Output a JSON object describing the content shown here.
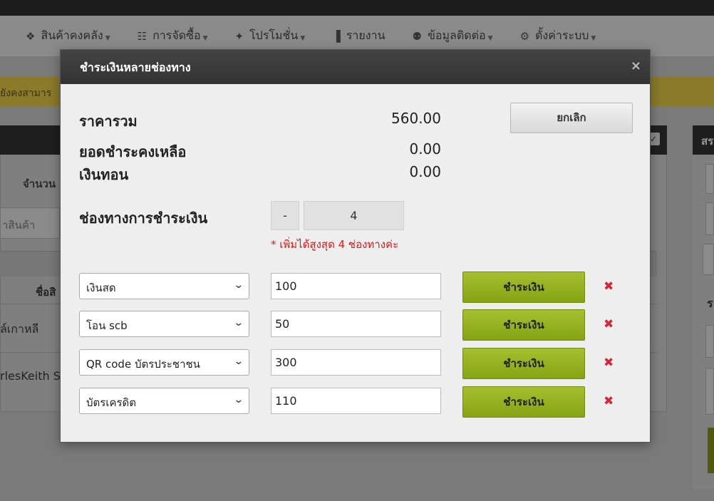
{
  "nav": {
    "items": [
      {
        "icon": "cubes-icon",
        "glyph": "❖",
        "label": "สินค้าคงคลัง",
        "dropdown": true
      },
      {
        "icon": "document-icon",
        "glyph": "☷",
        "label": "การจัดซื้อ",
        "dropdown": true
      },
      {
        "icon": "gift-icon",
        "glyph": "✦",
        "label": "โปรโมชั่น",
        "dropdown": true
      },
      {
        "icon": "bar-chart-icon",
        "glyph": "▐",
        "label": "รายงาน",
        "dropdown": false
      },
      {
        "icon": "users-icon",
        "glyph": "⚉",
        "label": "ข้อมูลติดต่อ",
        "dropdown": true
      },
      {
        "icon": "gear-icon",
        "glyph": "⚙",
        "label": "ตั้งค่าระบบ",
        "dropdown": true
      }
    ]
  },
  "background": {
    "alert_text": "ยังคงสามาร",
    "qty_label": "จำนวน",
    "search_placeholder": "าสินค้า",
    "col_name": "ชื่อสิ",
    "row1": "ล์เกาหลี",
    "row2": "rlesKeith S",
    "right_head": "สร",
    "right_text": "ร"
  },
  "modal": {
    "title": "ชำระเงินหลายช่องทาง",
    "close_glyph": "×",
    "summary": {
      "total_label": "ราคารวม",
      "total_value": "560.00",
      "remaining_label": "ยอดชำระคงเหลือ",
      "remaining_value": "0.00",
      "change_label": "เงินทอน",
      "change_value": "0.00"
    },
    "cancel_label": "ยกเลิก",
    "channels_label": "ช่องทางการชำระเงิน",
    "stepper_minus": "-",
    "channel_count": "4",
    "max_note": "* เพิ่มได้สูงสุด 4 ช่องทางค่ะ",
    "pay_label": "ชำระเงิน",
    "delete_glyph": "✖",
    "payments": [
      {
        "method": "เงินสด",
        "amount": "100"
      },
      {
        "method": "โอน scb",
        "amount": "50"
      },
      {
        "method": "QR code บัตรประชาชน",
        "amount": "300"
      },
      {
        "method": "บัตรเครดิต",
        "amount": "110"
      }
    ]
  }
}
